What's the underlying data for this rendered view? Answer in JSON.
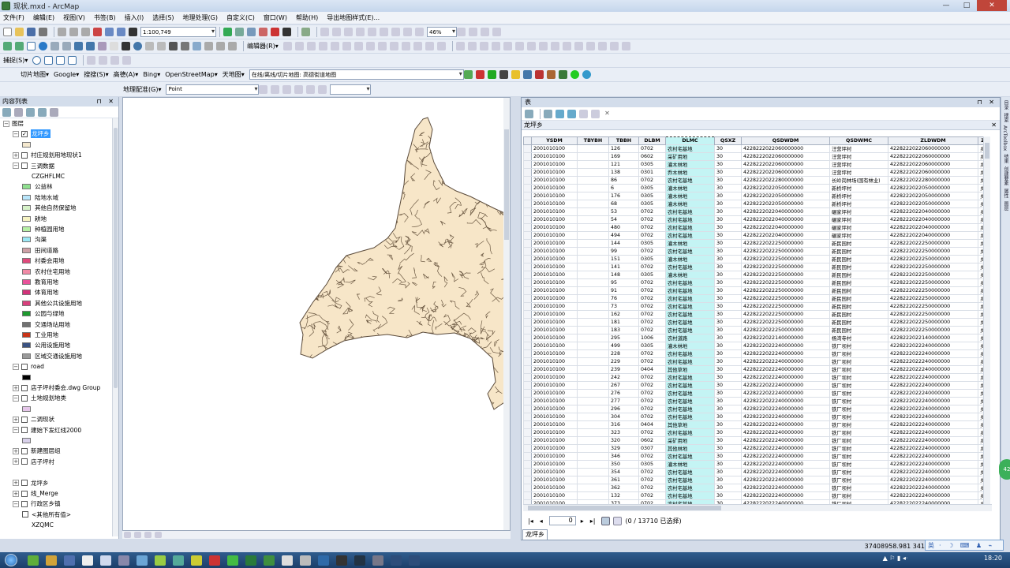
{
  "window": {
    "title": "现状.mxd - ArcMap",
    "btn_min": "—",
    "btn_max": "□",
    "btn_close": "✕"
  },
  "menu": [
    "文件(F)",
    "编辑(E)",
    "视图(V)",
    "书签(B)",
    "插入(I)",
    "选择(S)",
    "地理处理(G)",
    "自定义(C)",
    "窗口(W)",
    "帮助(H)",
    "导出地图样式(E)..."
  ],
  "toolbar": {
    "scale": "1:100,749",
    "zoom": "46%",
    "editor": "编辑器(R)▾",
    "capture": "捕捉(S)▾",
    "tile_map": "切片地图▾",
    "google": "Google▾",
    "search": "搜搜(S)▾",
    "gaode": "高德(A)▾",
    "bing": "Bing▾",
    "osm": "OpenStreetMap▾",
    "tianditu": "天地图▾",
    "online_tile": "在线/离线/切片地图: 高德街道地图",
    "georef": "地理配准(G)▾",
    "layer_combo": "Point"
  },
  "toc": {
    "title": "内容列表",
    "pins": "⊓ ✕",
    "rows": [
      {
        "label": "图层",
        "exp": "−",
        "chk": false,
        "indent": 0,
        "swatch": null
      },
      {
        "label": "龙坪乡",
        "exp": "−",
        "chk": true,
        "indent": 1,
        "swatch": null,
        "selected": true
      },
      {
        "label": "",
        "exp": null,
        "chk": false,
        "indent": 2,
        "swatch": "#f5e9cf"
      },
      {
        "label": "村庄规划用地现状1",
        "exp": "+",
        "chk": false,
        "indent": 1,
        "swatch": null
      },
      {
        "label": "三调数据",
        "exp": "−",
        "chk": false,
        "indent": 1,
        "swatch": null
      },
      {
        "label": "CZGHFLMC",
        "exp": null,
        "chk": false,
        "indent": 3,
        "swatch": null
      },
      {
        "label": "公益林",
        "exp": null,
        "chk": false,
        "indent": 2,
        "swatch": "#8fe08f"
      },
      {
        "label": "陆地水域",
        "exp": null,
        "chk": false,
        "indent": 2,
        "swatch": "#b9e6fb"
      },
      {
        "label": "其他自然保留地",
        "exp": null,
        "chk": false,
        "indent": 2,
        "swatch": "#d7f2c9"
      },
      {
        "label": "耕地",
        "exp": null,
        "chk": false,
        "indent": 2,
        "swatch": "#f6f3c3"
      },
      {
        "label": "种植园用地",
        "exp": null,
        "chk": false,
        "indent": 2,
        "swatch": "#b6f0a5"
      },
      {
        "label": "沟渠",
        "exp": null,
        "chk": false,
        "indent": 2,
        "swatch": "#9be8f5"
      },
      {
        "label": "田间道路",
        "exp": null,
        "chk": false,
        "indent": 2,
        "swatch": "#cda0a6"
      },
      {
        "label": "村委会用地",
        "exp": null,
        "chk": false,
        "indent": 2,
        "swatch": "#e04a7c"
      },
      {
        "label": "农村住宅用地",
        "exp": null,
        "chk": false,
        "indent": 2,
        "swatch": "#f08aa6"
      },
      {
        "label": "教育用地",
        "exp": null,
        "chk": false,
        "indent": 2,
        "swatch": "#e8529a"
      },
      {
        "label": "体育用地",
        "exp": null,
        "chk": false,
        "indent": 2,
        "swatch": "#d2327a"
      },
      {
        "label": "其他公共设施用地",
        "exp": null,
        "chk": false,
        "indent": 2,
        "swatch": "#d8407c"
      },
      {
        "label": "公园与绿地",
        "exp": null,
        "chk": false,
        "indent": 2,
        "swatch": "#1d9a2e"
      },
      {
        "label": "交通场站用地",
        "exp": null,
        "chk": false,
        "indent": 2,
        "swatch": "#717171"
      },
      {
        "label": "工业用地",
        "exp": null,
        "chk": false,
        "indent": 2,
        "swatch": "#c83418"
      },
      {
        "label": "公用设施用地",
        "exp": null,
        "chk": false,
        "indent": 2,
        "swatch": "#3a5282"
      },
      {
        "label": "区域交通设施用地",
        "exp": null,
        "chk": false,
        "indent": 2,
        "swatch": "#9a9a9a"
      },
      {
        "label": "road",
        "exp": "−",
        "chk": false,
        "indent": 1,
        "swatch": null
      },
      {
        "label": "",
        "exp": null,
        "chk": false,
        "indent": 2,
        "swatch": "#000000"
      },
      {
        "label": "店子坪村委会.dwg Group",
        "exp": "+",
        "chk": false,
        "indent": 1,
        "swatch": null
      },
      {
        "label": "土地规划地类",
        "exp": "−",
        "chk": false,
        "indent": 1,
        "swatch": null
      },
      {
        "label": "",
        "exp": null,
        "chk": false,
        "indent": 2,
        "swatch": "#e6c6ea"
      },
      {
        "label": "二调现状",
        "exp": "+",
        "chk": false,
        "indent": 1,
        "swatch": null
      },
      {
        "label": "建始下发红线2000",
        "exp": "−",
        "chk": false,
        "indent": 1,
        "swatch": null
      },
      {
        "label": "",
        "exp": null,
        "chk": false,
        "indent": 2,
        "swatch": "#d8d0ea"
      },
      {
        "label": "新建图层组",
        "exp": "+",
        "chk": false,
        "indent": 1,
        "swatch": null
      },
      {
        "label": "店子坪村",
        "exp": "+",
        "chk": false,
        "indent": 1,
        "swatch": null
      },
      {
        "label": "",
        "exp": null,
        "chk": false,
        "indent": 1,
        "swatch": null
      },
      {
        "label": "龙坪乡",
        "exp": "+",
        "chk": false,
        "indent": 1,
        "swatch": null
      },
      {
        "label": "线_Merge",
        "exp": "+",
        "chk": false,
        "indent": 1,
        "swatch": null
      },
      {
        "label": "行政区乡镇",
        "exp": "−",
        "chk": false,
        "indent": 1,
        "swatch": null
      },
      {
        "label": "<其他所有值>",
        "exp": null,
        "chk": false,
        "indent": 2,
        "swatch": "chk"
      },
      {
        "label": "XZQMC",
        "exp": null,
        "chk": false,
        "indent": 3,
        "swatch": null
      }
    ]
  },
  "table": {
    "window_title": "表",
    "tab_name": "龙坪乡",
    "bottom_tab": "龙坪乡",
    "columns": [
      "YSDM",
      "TBYBH",
      "TBBH",
      "DLBM",
      "DLMC",
      "QSXZ",
      "QSDWDM",
      "QSDWMC",
      "ZLDWDM",
      "Z"
    ],
    "rows": [
      [
        "2001010100",
        "",
        "126",
        "0702",
        "农村宅基地",
        "30",
        "4228222022060000000",
        "汪营坪村",
        "4228222022060000000",
        "乡"
      ],
      [
        "2001010100",
        "",
        "169",
        "0602",
        "采矿用地",
        "30",
        "4228222022060000000",
        "汪营坪村",
        "4228222022060000000",
        "乡"
      ],
      [
        "2001010100",
        "",
        "121",
        "0305",
        "灌木林地",
        "30",
        "4228222022060000000",
        "汪营坪村",
        "4228222022060000000",
        "乡"
      ],
      [
        "2001010100",
        "",
        "138",
        "0301",
        "乔木林地",
        "30",
        "4228222022060000000",
        "汪营坪村",
        "4228222022060000000",
        "乡"
      ],
      [
        "2001010100",
        "",
        "86",
        "0702",
        "农村宅基地",
        "30",
        "4228222022280000000",
        "长岭岗林场(国有林业)",
        "4228222022280000000",
        "乡"
      ],
      [
        "2001010100",
        "",
        "6",
        "0305",
        "灌木林地",
        "30",
        "4228222022050000000",
        "新桥坪村",
        "4228222022050000000",
        "乡"
      ],
      [
        "2001010100",
        "",
        "176",
        "0305",
        "灌木林地",
        "30",
        "4228222022050000000",
        "新桥坪村",
        "4228222022050000000",
        "乡"
      ],
      [
        "2001010100",
        "",
        "68",
        "0305",
        "灌木林地",
        "30",
        "4228222022050000000",
        "新桥坪村",
        "4228222022050000000",
        "乡"
      ],
      [
        "2001010100",
        "",
        "53",
        "0702",
        "农村宅基地",
        "30",
        "4228222022040000000",
        "碾家坪村",
        "4228222022040000000",
        "乡"
      ],
      [
        "2001010100",
        "",
        "54",
        "0702",
        "农村宅基地",
        "30",
        "4228222022040000000",
        "碾家坪村",
        "4228222022040000000",
        "乡"
      ],
      [
        "2001010100",
        "",
        "480",
        "0702",
        "农村宅基地",
        "30",
        "4228222022040000000",
        "碾家坪村",
        "4228222022040000000",
        "乡"
      ],
      [
        "2001010100",
        "",
        "494",
        "0702",
        "农村宅基地",
        "30",
        "4228222022040000000",
        "碾家坪村",
        "4228222022040000000",
        "乡"
      ],
      [
        "2001010100",
        "",
        "144",
        "0305",
        "灌木林地",
        "30",
        "4228222022250000000",
        "新民园村",
        "4228222022250000000",
        "乡"
      ],
      [
        "2001010100",
        "",
        "99",
        "0702",
        "农村宅基地",
        "30",
        "4228222022250000000",
        "新民园村",
        "4228222022250000000",
        "乡"
      ],
      [
        "2001010100",
        "",
        "151",
        "0305",
        "灌木林地",
        "30",
        "4228222022250000000",
        "新民园村",
        "4228222022250000000",
        "乡"
      ],
      [
        "2001010100",
        "",
        "141",
        "0702",
        "农村宅基地",
        "30",
        "4228222022250000000",
        "新民园村",
        "4228222022250000000",
        "乡"
      ],
      [
        "2001010100",
        "",
        "148",
        "0305",
        "灌木林地",
        "30",
        "4228222022250000000",
        "新民园村",
        "4228222022250000000",
        "乡"
      ],
      [
        "2001010100",
        "",
        "95",
        "0702",
        "农村宅基地",
        "30",
        "4228222022250000000",
        "新民园村",
        "4228222022250000000",
        "乡"
      ],
      [
        "2001010100",
        "",
        "91",
        "0702",
        "农村宅基地",
        "30",
        "4228222022250000000",
        "新民园村",
        "4228222022250000000",
        "乡"
      ],
      [
        "2001010100",
        "",
        "76",
        "0702",
        "农村宅基地",
        "30",
        "4228222022250000000",
        "新民园村",
        "4228222022250000000",
        "乡"
      ],
      [
        "2001010100",
        "",
        "73",
        "0702",
        "农村宅基地",
        "30",
        "4228222022250000000",
        "新民园村",
        "4228222022250000000",
        "乡"
      ],
      [
        "2001010100",
        "",
        "162",
        "0702",
        "农村宅基地",
        "30",
        "4228222022250000000",
        "新民园村",
        "4228222022250000000",
        "乡"
      ],
      [
        "2001010100",
        "",
        "181",
        "0702",
        "农村宅基地",
        "30",
        "4228222022250000000",
        "新民园村",
        "4228222022250000000",
        "乡"
      ],
      [
        "2001010100",
        "",
        "183",
        "0702",
        "农村宅基地",
        "30",
        "4228222022250000000",
        "新民园村",
        "4228222022250000000",
        "乡"
      ],
      [
        "2001010100",
        "",
        "295",
        "1006",
        "农村道路",
        "30",
        "4228222022140000000",
        "杨湾寺村",
        "4228222022140000000",
        "乡"
      ],
      [
        "2001010100",
        "",
        "499",
        "0305",
        "灌木林地",
        "30",
        "4228222022240000000",
        "铁厂坝村",
        "4228222022240000000",
        "乡"
      ],
      [
        "2001010100",
        "",
        "228",
        "0702",
        "农村宅基地",
        "30",
        "4228222022240000000",
        "铁厂坝村",
        "4228222022240000000",
        "乡"
      ],
      [
        "2001010100",
        "",
        "229",
        "0702",
        "农村宅基地",
        "30",
        "4228222022240000000",
        "铁厂坝村",
        "4228222022240000000",
        "乡"
      ],
      [
        "2001010100",
        "",
        "239",
        "0404",
        "其他草地",
        "30",
        "4228222022240000000",
        "铁厂坝村",
        "4228222022240000000",
        "乡"
      ],
      [
        "2001010100",
        "",
        "242",
        "0702",
        "农村宅基地",
        "30",
        "4228222022240000000",
        "铁厂坝村",
        "4228222022240000000",
        "乡"
      ],
      [
        "2001010100",
        "",
        "267",
        "0702",
        "农村宅基地",
        "30",
        "4228222022240000000",
        "铁厂坝村",
        "4228222022240000000",
        "乡"
      ],
      [
        "2001010100",
        "",
        "276",
        "0702",
        "农村宅基地",
        "30",
        "4228222022240000000",
        "铁厂坝村",
        "4228222022240000000",
        "乡"
      ],
      [
        "2001010100",
        "",
        "277",
        "0702",
        "农村宅基地",
        "30",
        "4228222022240000000",
        "铁厂坝村",
        "4228222022240000000",
        "乡"
      ],
      [
        "2001010100",
        "",
        "296",
        "0702",
        "农村宅基地",
        "30",
        "4228222022240000000",
        "铁厂坝村",
        "4228222022240000000",
        "乡"
      ],
      [
        "2001010100",
        "",
        "304",
        "0702",
        "农村宅基地",
        "30",
        "4228222022240000000",
        "铁厂坝村",
        "4228222022240000000",
        "乡"
      ],
      [
        "2001010100",
        "",
        "316",
        "0404",
        "其他草地",
        "30",
        "4228222022240000000",
        "铁厂坝村",
        "4228222022240000000",
        "乡"
      ],
      [
        "2001010100",
        "",
        "323",
        "0702",
        "农村宅基地",
        "30",
        "4228222022240000000",
        "铁厂坝村",
        "4228222022240000000",
        "乡"
      ],
      [
        "2001010100",
        "",
        "320",
        "0602",
        "采矿用地",
        "30",
        "4228222022240000000",
        "铁厂坝村",
        "4228222022240000000",
        "乡"
      ],
      [
        "2001010100",
        "",
        "329",
        "0307",
        "其他林地",
        "30",
        "4228222022240000000",
        "铁厂坝村",
        "4228222022240000000",
        "乡"
      ],
      [
        "2001010100",
        "",
        "346",
        "0702",
        "农村宅基地",
        "30",
        "4228222022240000000",
        "铁厂坝村",
        "4228222022240000000",
        "乡"
      ],
      [
        "2001010100",
        "",
        "350",
        "0305",
        "灌木林地",
        "30",
        "4228222022240000000",
        "铁厂坝村",
        "4228222022240000000",
        "乡"
      ],
      [
        "2001010100",
        "",
        "354",
        "0702",
        "农村宅基地",
        "30",
        "4228222022240000000",
        "铁厂坝村",
        "4228222022240000000",
        "乡"
      ],
      [
        "2001010100",
        "",
        "361",
        "0702",
        "农村宅基地",
        "30",
        "4228222022240000000",
        "铁厂坝村",
        "4228222022240000000",
        "乡"
      ],
      [
        "2001010100",
        "",
        "362",
        "0702",
        "农村宅基地",
        "30",
        "4228222022240000000",
        "铁厂坝村",
        "4228222022240000000",
        "乡"
      ],
      [
        "2001010100",
        "",
        "132",
        "0702",
        "农村宅基地",
        "30",
        "4228222022240000000",
        "铁厂坝村",
        "4228222022240000000",
        "乡"
      ],
      [
        "2001010100",
        "",
        "373",
        "0702",
        "农村宅基地",
        "30",
        "4228222022240000000",
        "铁厂坝村",
        "4228222022240000000",
        "乡"
      ]
    ],
    "nav": {
      "page": "0",
      "status": "(0 / 13710 已选择)"
    }
  },
  "status": {
    "coords": "37408958.981  341"
  },
  "ime": {
    "label": "英",
    "icons": "· ☽ ⌨ ♟ ⌁"
  },
  "taskbar": {
    "tray": "▲ ⚐ ▮ ◂ᐧ",
    "clock": "18:20"
  },
  "right_dock": [
    "目录",
    "搜索",
    "ArcToolbox",
    "结果",
    "创建要素",
    "属性",
    "图层"
  ],
  "bubble": "42",
  "colors": {
    "map_fill": "#f7e6c8",
    "map_stroke": "#5a4a3a",
    "dlmc_highlight": "#c4f4f4"
  }
}
